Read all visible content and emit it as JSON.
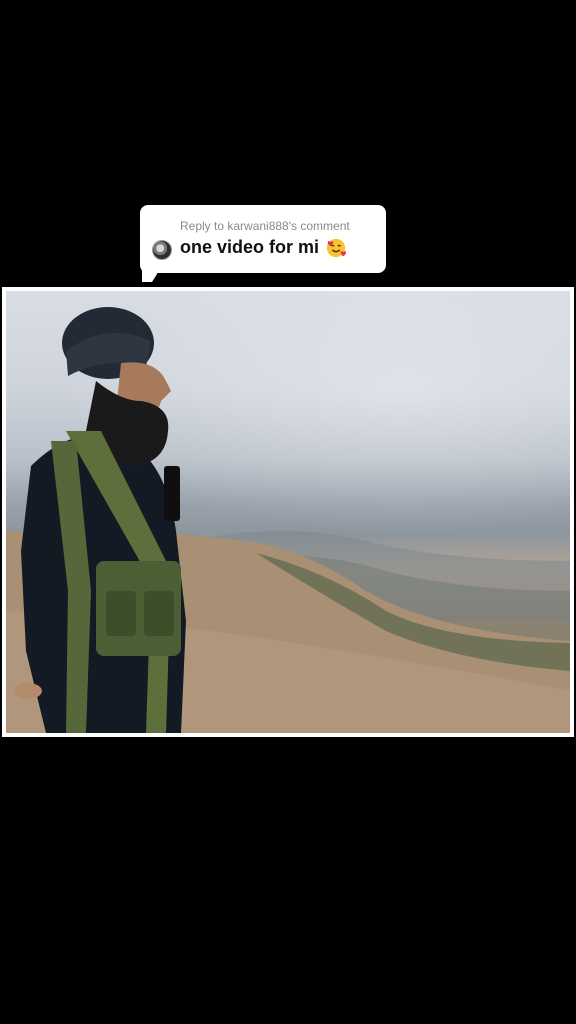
{
  "reply": {
    "title": "Reply to karwani888's comment",
    "text": "one video for mi",
    "emoji_icon": "smiling-face-with-hearts-icon"
  },
  "photo": {
    "subject": "man-in-turban-on-mountain-photo"
  }
}
